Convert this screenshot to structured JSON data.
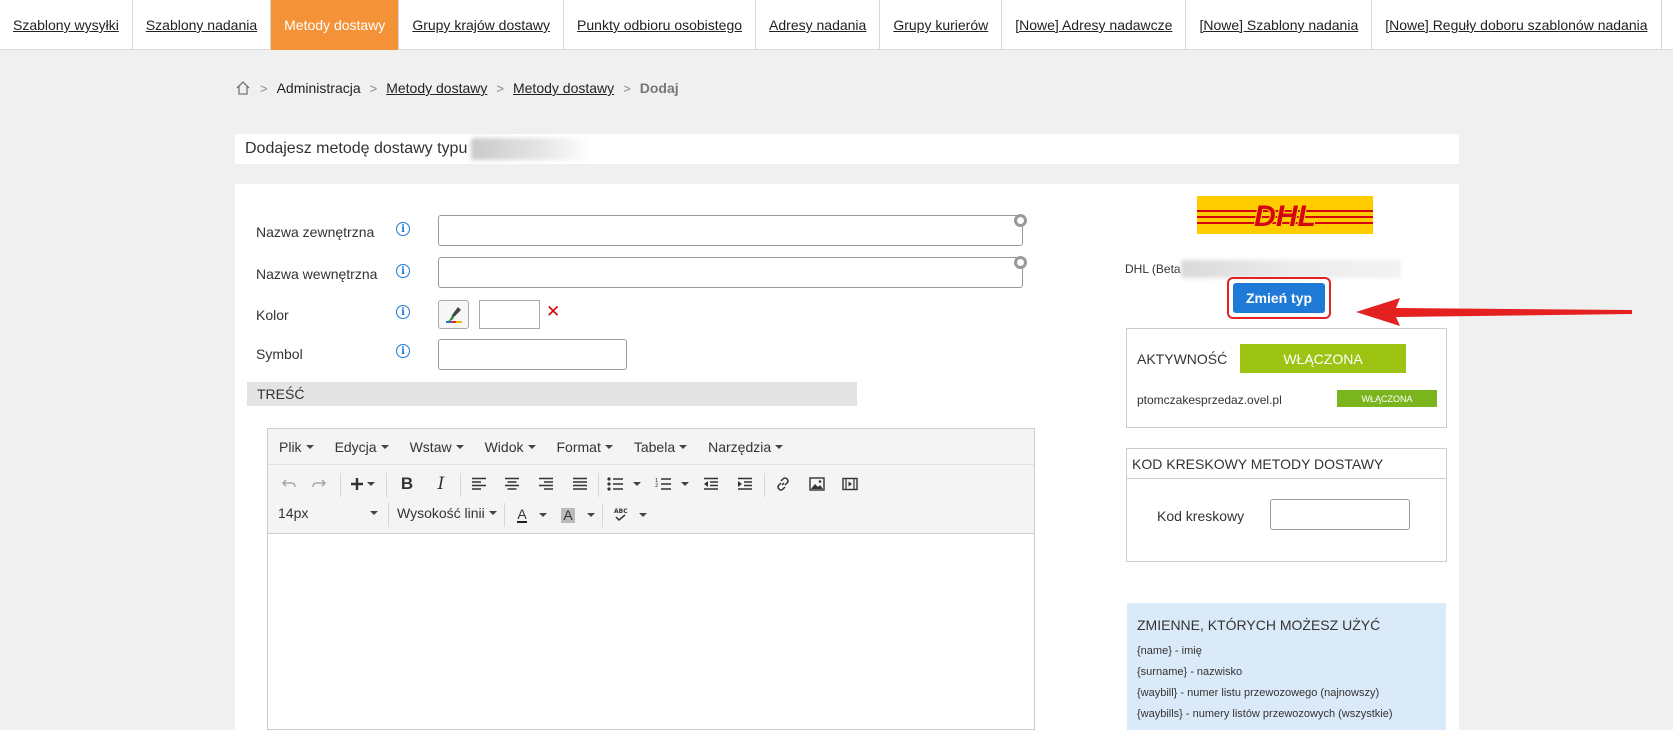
{
  "topnav": {
    "tabs": [
      {
        "label": "Szablony wysyłki",
        "active": false
      },
      {
        "label": "Szablony nadania",
        "active": false
      },
      {
        "label": "Metody dostawy",
        "active": true
      },
      {
        "label": "Grupy krajów dostawy",
        "active": false
      },
      {
        "label": "Punkty odbioru osobistego",
        "active": false
      },
      {
        "label": "Adresy nadania",
        "active": false
      },
      {
        "label": "Grupy kurierów",
        "active": false
      },
      {
        "label": "[Nowe] Adresy nadawcze",
        "active": false
      },
      {
        "label": "[Nowe] Szablony nadania",
        "active": false
      },
      {
        "label": "[Nowe] Reguły doboru szablonów nadania",
        "active": false
      }
    ]
  },
  "breadcrumb": {
    "items": [
      {
        "label": "Administracja",
        "link": false
      },
      {
        "label": "Metody dostawy",
        "link": true
      },
      {
        "label": "Metody dostawy",
        "link": true
      },
      {
        "label": "Dodaj",
        "link": false
      }
    ]
  },
  "title": {
    "text": "Dodajesz metodę dostawy typu"
  },
  "form": {
    "external_name_label": "Nazwa zewnętrzna",
    "internal_name_label": "Nazwa wewnętrzna",
    "color_label": "Kolor",
    "symbol_label": "Symbol",
    "info_glyph": "i",
    "clear_glyph": "✕",
    "tresc_label": "TREŚĆ"
  },
  "editor": {
    "menu": [
      "Plik",
      "Edycja",
      "Wstaw",
      "Widok",
      "Format",
      "Tabela",
      "Narzędzia"
    ],
    "font_size": "14px",
    "line_height_label": "Wysokość linii",
    "text_color_glyph": "A",
    "bg_color_glyph": "A"
  },
  "carrier": {
    "logo_text": "DHL",
    "name_prefix": "DHL (Beta",
    "change_type_button": "Zmień typ"
  },
  "activity": {
    "title": "AKTYWNOŚĆ",
    "status": "WŁĄCZONA",
    "domain": "ptomczakesprzedaz.ovel.pl",
    "domain_status": "WŁĄCZONA"
  },
  "barcode": {
    "title": "KOD KRESKOWY METODY DOSTAWY",
    "label": "Kod kreskowy"
  },
  "variables": {
    "title": "ZMIENNE, KTÓRYCH MOŻESZ UŻYĆ",
    "items": [
      "{name} - imię",
      "{surname} - nazwisko",
      "{waybill} - numer listu przewozowego (najnowszy)",
      "{waybills} - numery listów przewozowych (wszystkie)"
    ]
  },
  "colors": {
    "accent_orange": "#f39237",
    "primary_blue": "#1e7ad6",
    "highlight_red": "#e52020",
    "active_green": "#9dc412",
    "dhl_yellow": "#ffcc00",
    "dhl_red": "#d40511"
  }
}
